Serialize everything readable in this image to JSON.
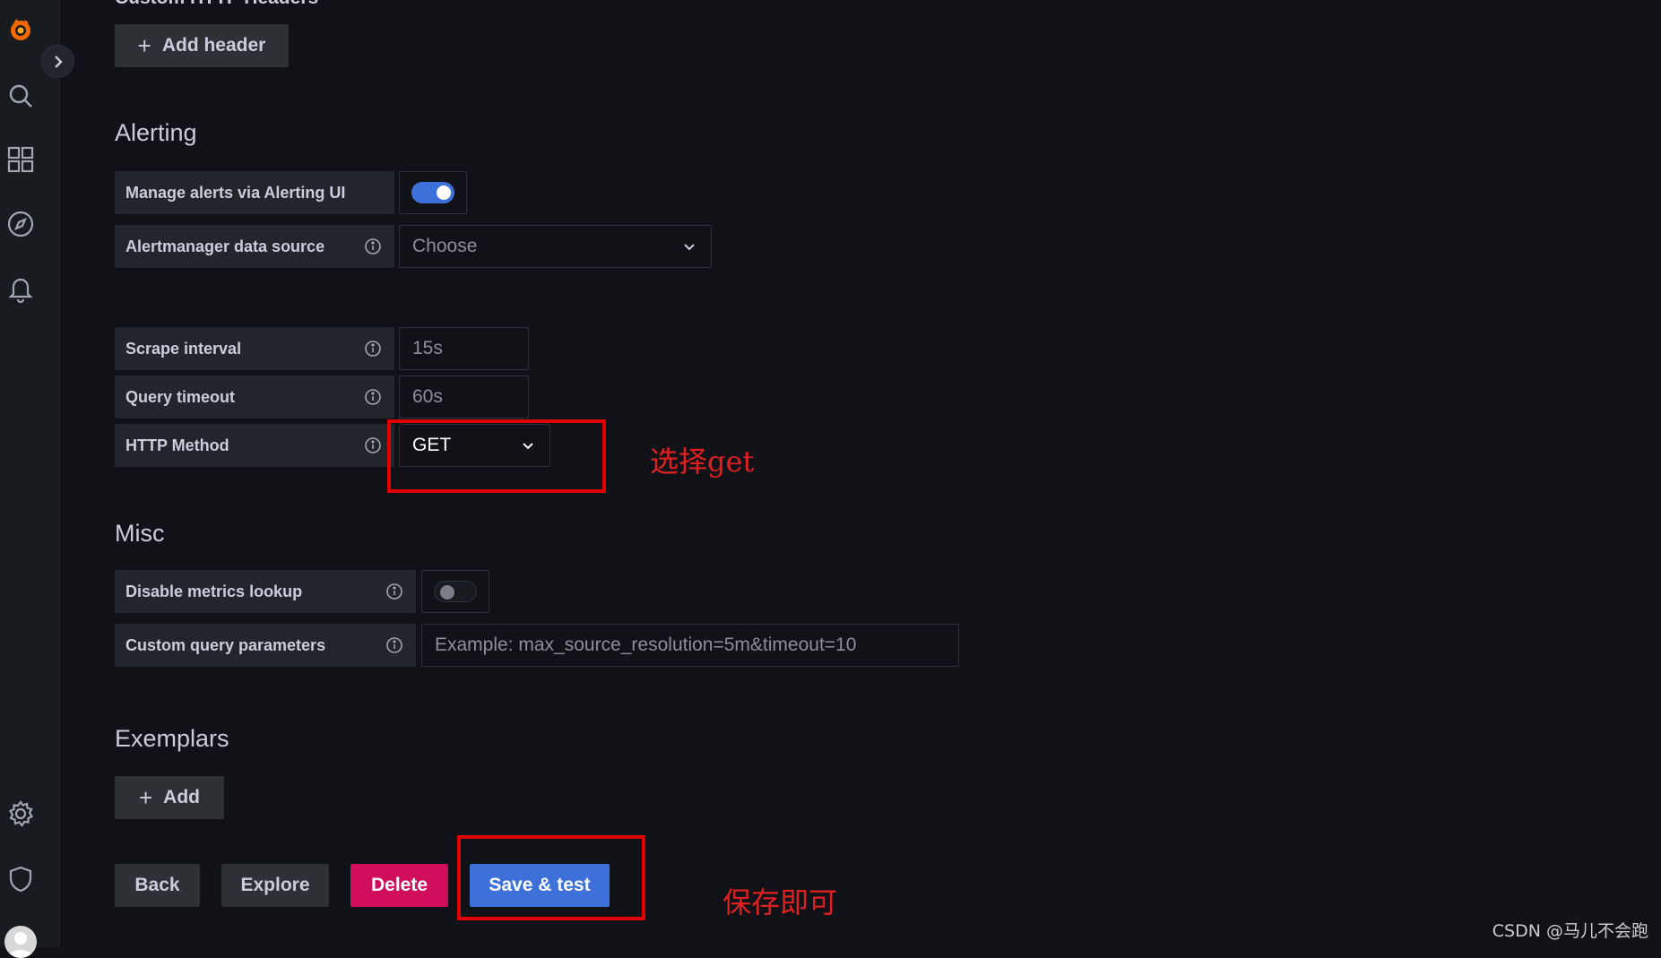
{
  "colors": {
    "accent": "#3d71d9",
    "danger": "#d10e5c",
    "annotation": "#e02020",
    "background": "#111217"
  },
  "sidebar": {
    "icons": [
      "grafana-logo-icon",
      "search-icon",
      "dashboards-icon",
      "explore-icon",
      "alerting-icon",
      "settings-icon",
      "shield-icon"
    ]
  },
  "top": {
    "cut_heading": "Custom HTTP Headers",
    "add_header_label": "Add header"
  },
  "alerting": {
    "title": "Alerting",
    "manage_label": "Manage alerts via Alerting UI",
    "manage_enabled": true,
    "alertmanager_label": "Alertmanager data source",
    "alertmanager_value": "Choose"
  },
  "settings": {
    "scrape_label": "Scrape interval",
    "scrape_placeholder": "15s",
    "timeout_label": "Query timeout",
    "timeout_placeholder": "60s",
    "http_method_label": "HTTP Method",
    "http_method_value": "GET"
  },
  "misc": {
    "title": "Misc",
    "disable_metrics_label": "Disable metrics lookup",
    "disable_metrics_enabled": false,
    "custom_query_label": "Custom query parameters",
    "custom_query_placeholder": "Example: max_source_resolution=5m&timeout=10"
  },
  "exemplars": {
    "title": "Exemplars",
    "add_label": "Add"
  },
  "actions": {
    "back": "Back",
    "explore": "Explore",
    "delete": "Delete",
    "save_test": "Save & test"
  },
  "annotations": {
    "select_get": "选择get",
    "save_ok": "保存即可"
  },
  "watermark": "CSDN @马儿不会跑"
}
